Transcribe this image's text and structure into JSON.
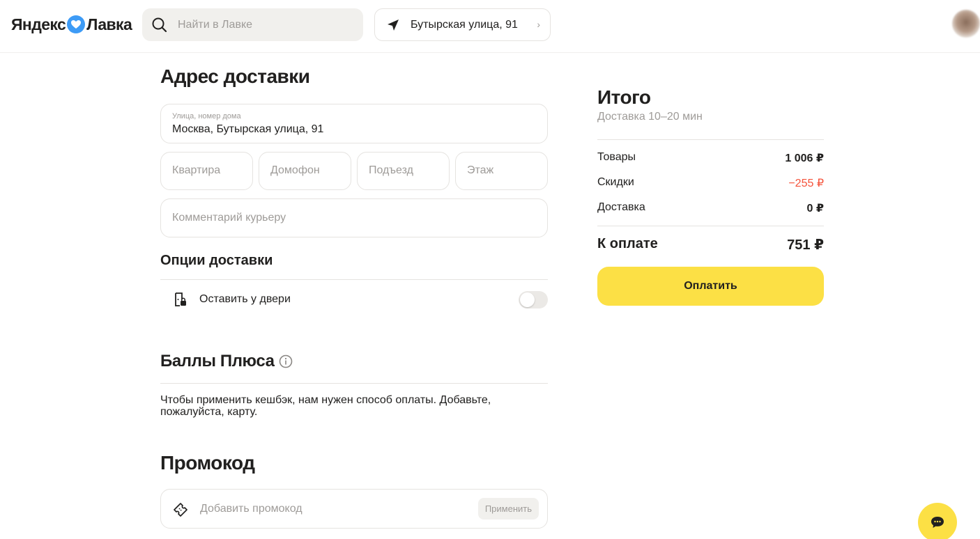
{
  "header": {
    "logo_left": "Яндекс",
    "logo_right": "Лавка",
    "search_placeholder": "Найти в Лавке",
    "address": "Бутырская улица, 91",
    "icons": [
      "search-icon",
      "location-arrow-icon",
      "chevron-right-icon",
      "avatar"
    ]
  },
  "delivery_address": {
    "title": "Адрес доставки",
    "street_label": "Улица, номер дома",
    "street_value": "Москва, Бутырская улица, 91",
    "apartment_placeholder": "Квартира",
    "intercom_placeholder": "Домофон",
    "entrance_placeholder": "Подъезд",
    "floor_placeholder": "Этаж",
    "comment_placeholder": "Комментарий курьеру"
  },
  "delivery_options": {
    "title": "Опции доставки",
    "leave_at_door_label": "Оставить у двери",
    "leave_at_door_enabled": false
  },
  "plus_points": {
    "title": "Баллы Плюса",
    "message": "Чтобы применить кешбэк, нам нужен способ оплаты. Добавьте, пожалуйста, карту."
  },
  "promo": {
    "title": "Промокод",
    "placeholder": "Добавить промокод",
    "apply_label": "Применить"
  },
  "summary": {
    "title": "Итого",
    "delivery_time": "Доставка 10–20 мин",
    "goods_label": "Товары",
    "goods_value": "1 006 ₽",
    "discount_label": "Скидки",
    "discount_value": "−255 ₽",
    "delivery_label": "Доставка",
    "delivery_value": "0 ₽",
    "to_pay_label": "К оплате",
    "to_pay_value": "751 ₽",
    "pay_button": "Оплатить"
  },
  "colors": {
    "accent_yellow": "#fce045",
    "discount_red": "#f5523a",
    "logo_heart_blue": "#3d9bf6",
    "muted_text": "#9e9b98"
  }
}
